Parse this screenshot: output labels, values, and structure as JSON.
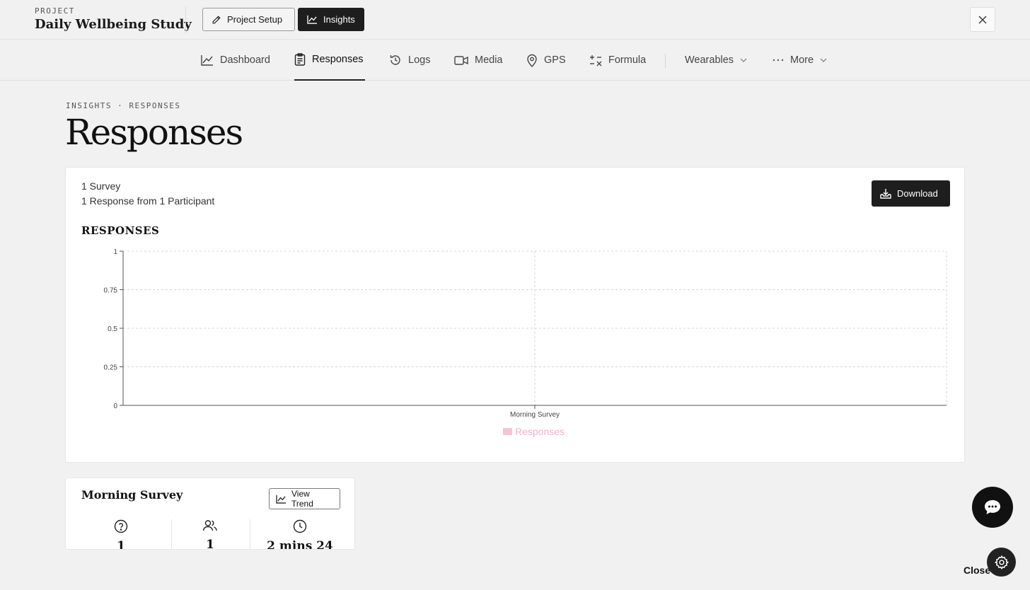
{
  "header": {
    "kicker": "PROJECT",
    "project_title": "Daily Wellbeing Study",
    "project_setup_label": "Project Setup",
    "insights_label": "Insights"
  },
  "nav": {
    "dashboard": "Dashboard",
    "responses": "Responses",
    "logs": "Logs",
    "media": "Media",
    "gps": "GPS",
    "formula": "Formula",
    "wearables": "Wearables",
    "more": "More"
  },
  "page": {
    "breadcrumb": "INSIGHTS · RESPONSES",
    "title": "Responses"
  },
  "summary": {
    "surveys": "1 Survey",
    "responses": "1 Response from 1 Participant",
    "download_label": "Download"
  },
  "chart_data": {
    "type": "bar",
    "title": "RESPONSES",
    "categories": [
      "Morning Survey"
    ],
    "series": [
      {
        "name": "Responses",
        "values": [
          0
        ],
        "color": "#f2c6d0"
      }
    ],
    "ylim": [
      0,
      1
    ],
    "yticks": [
      "0",
      "0.25",
      "0.5",
      "0.75",
      "1"
    ],
    "grid": true,
    "legend": "bottom"
  },
  "survey": {
    "title": "Morning Survey",
    "view_trend_label": "View Trend",
    "stats": [
      "1",
      "1",
      "2 mins 24"
    ]
  },
  "footer": {
    "close_label": "Close"
  },
  "colors": {
    "dark": "#1e1e1e",
    "legend_pink": "#f2c6d0",
    "legend_text": "#f0b2c2"
  }
}
